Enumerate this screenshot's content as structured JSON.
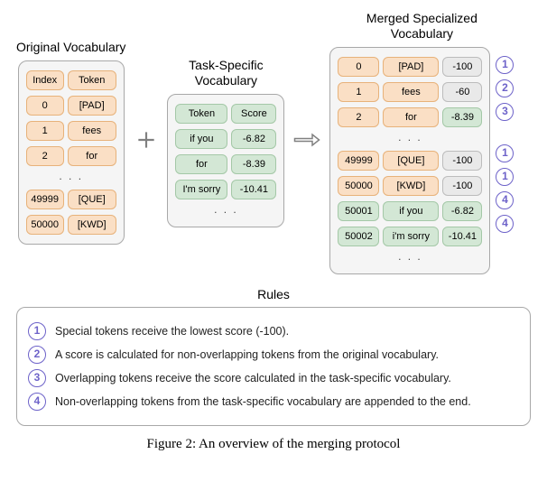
{
  "original": {
    "title": "Original Vocabulary",
    "h1": "Index",
    "h2": "Token",
    "r1c1": "0",
    "r1c2": "[PAD]",
    "r2c1": "1",
    "r2c2": "fees",
    "r3c1": "2",
    "r3c2": "for",
    "r4c1": "49999",
    "r4c2": "[QUE]",
    "r5c1": "50000",
    "r5c2": "[KWD]"
  },
  "task": {
    "title": "Task-Specific Vocabulary",
    "h1": "Token",
    "h2": "Score",
    "r1c1": "if you",
    "r1c2": "-6.82",
    "r2c1": "for",
    "r2c2": "-8.39",
    "r3c1": "I'm sorry",
    "r3c2": "-10.41"
  },
  "merged": {
    "title": "Merged Specialized Vocabulary",
    "r1c1": "0",
    "r1c2": "[PAD]",
    "r1c3": "-100",
    "r1b": "1",
    "r2c1": "1",
    "r2c2": "fees",
    "r2c3": "-60",
    "r2b": "2",
    "r3c1": "2",
    "r3c2": "for",
    "r3c3": "-8.39",
    "r3b": "3",
    "r4c1": "49999",
    "r4c2": "[QUE]",
    "r4c3": "-100",
    "r4b": "1",
    "r5c1": "50000",
    "r5c2": "[KWD]",
    "r5c3": "-100",
    "r5b": "1",
    "r6c1": "50001",
    "r6c2": "if you",
    "r6c3": "-6.82",
    "r6b": "4",
    "r7c1": "50002",
    "r7c2": "i'm sorry",
    "r7c3": "-10.41",
    "r7b": "4"
  },
  "rules": {
    "title": "Rules",
    "r1n": "1",
    "r1t": "Special tokens receive the lowest score (-100).",
    "r2n": "2",
    "r2t": "A score is calculated for non-overlapping tokens from the original vocabulary.",
    "r3n": "3",
    "r3t": "Overlapping tokens receive the score calculated in the task-specific vocabulary.",
    "r4n": "4",
    "r4t": "Non-overlapping tokens from the task-specific vocabulary are appended to the end."
  },
  "caption": "Figure 2: An overview of the merging protocol"
}
